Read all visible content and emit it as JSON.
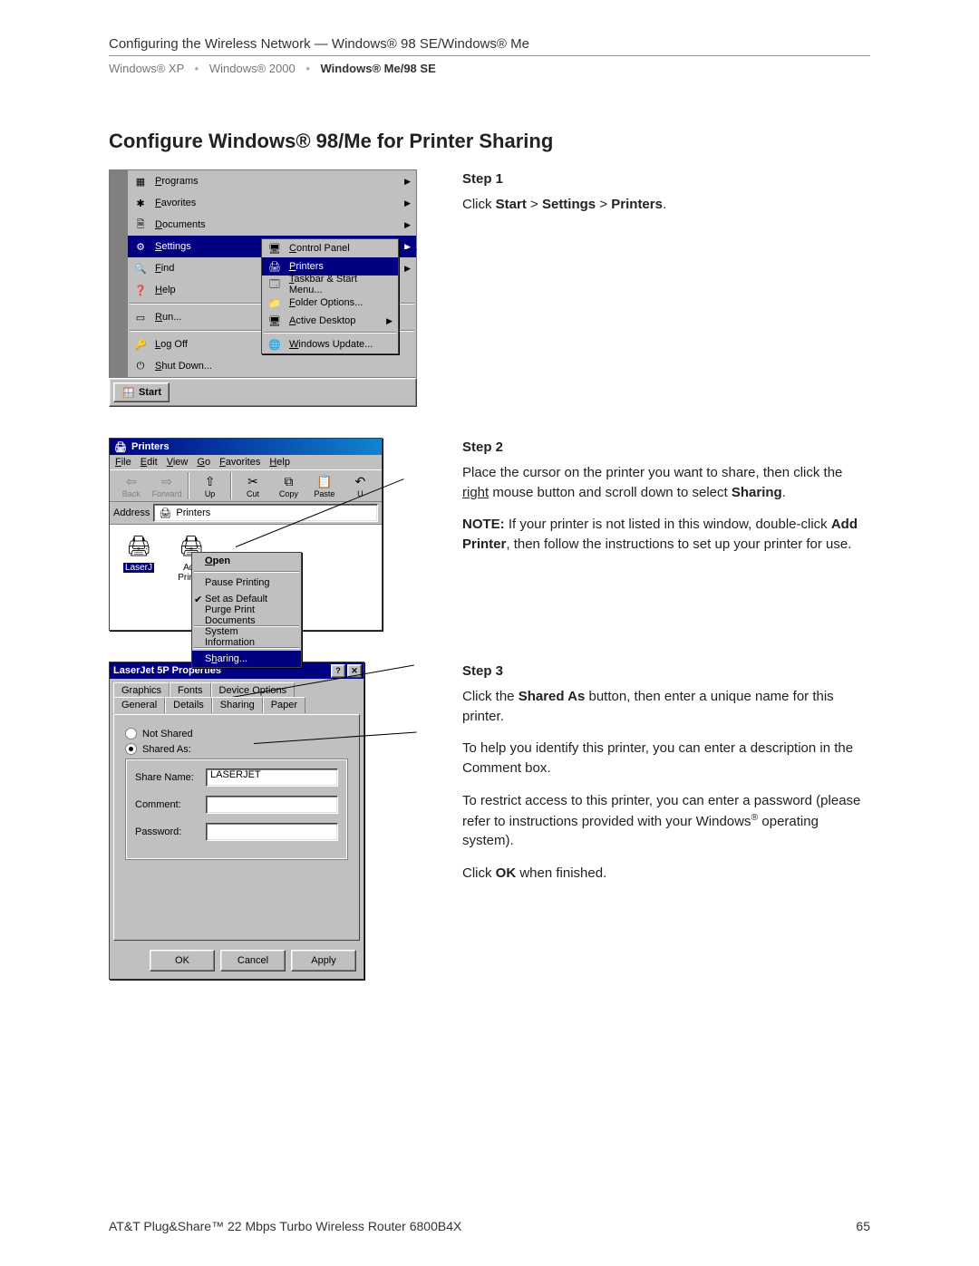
{
  "header": {
    "section": "Configuring the Wireless Network — Windows® 98 SE/Windows® Me",
    "breadcrumb": {
      "a": "Windows® XP",
      "b": "Windows® 2000",
      "c": "Windows® Me/98 SE"
    }
  },
  "title": "Configure Windows® 98/Me for Printer Sharing",
  "start_menu": {
    "items": [
      {
        "icon": "▦",
        "label": "Programs",
        "arrow": true
      },
      {
        "icon": "✱",
        "label": "Favorites",
        "arrow": true
      },
      {
        "icon": "🗎",
        "label": "Documents",
        "arrow": true
      },
      {
        "icon": "⚙",
        "label": "Settings",
        "arrow": true,
        "hl": true
      },
      {
        "icon": "🔍",
        "label": "Find",
        "arrow": true
      },
      {
        "icon": "❓",
        "label": "Help",
        "arrow": false
      },
      {
        "icon": "▭",
        "label": "Run...",
        "arrow": false
      },
      {
        "icon": "🔑",
        "label": "Log Off",
        "arrow": false
      },
      {
        "icon": "⏻",
        "label": "Shut Down...",
        "arrow": false
      }
    ],
    "settings_submenu": [
      {
        "icon": "🖥",
        "label": "Control Panel"
      },
      {
        "icon": "🖨",
        "label": "Printers",
        "hl": true
      },
      {
        "icon": "🗔",
        "label": "Taskbar & Start Menu..."
      },
      {
        "icon": "📁",
        "label": "Folder Options..."
      },
      {
        "icon": "🖥",
        "label": "Active Desktop",
        "arrow": true
      },
      {
        "icon": "🌐",
        "label": "Windows Update..."
      }
    ],
    "start_button": "Start"
  },
  "step1": {
    "label": "Step 1",
    "text_pre": "Click ",
    "b1": "Start",
    "gt1": " > ",
    "b2": "Settings",
    "gt2": " > ",
    "b3": "Printers",
    "end": "."
  },
  "printers_window": {
    "title": "Printers",
    "menus": [
      "File",
      "Edit",
      "View",
      "Go",
      "Favorites",
      "Help"
    ],
    "toolbar": [
      "Back",
      "Forward",
      "Up",
      "Cut",
      "Copy",
      "Paste",
      "U"
    ],
    "address_label": "Address",
    "address_value": "Printers",
    "icons": [
      {
        "name": "Add Printer",
        "glyph": "🖨"
      },
      {
        "name": "LaserJ",
        "glyph": "🖨",
        "sel": true
      }
    ],
    "context_menu": [
      {
        "label": "Open",
        "bold": true
      },
      {
        "sep": true
      },
      {
        "label": "Pause Printing"
      },
      {
        "label": "Set as Default",
        "checked": true
      },
      {
        "label": "Purge Print Documents"
      },
      {
        "sep": true
      },
      {
        "label": "System Information"
      },
      {
        "sep": true
      },
      {
        "label": "Sharing...",
        "hl": true
      }
    ]
  },
  "step2": {
    "label": "Step 2",
    "l1a": "Place the cursor on the printer you want to share, then click the ",
    "l1u": "right",
    "l1b": " mouse button and scroll down to select ",
    "l1bold": "Sharing",
    "l1end": ".",
    "note_label": "NOTE:",
    "note_a": " If your printer is not listed in this window, double-click ",
    "note_b": "Add Printer",
    "note_c": ", then follow the instructions to set up your printer for use."
  },
  "props": {
    "title": "LaserJet 5P Properties",
    "tabs_top": [
      "Graphics",
      "Fonts",
      "Device Options"
    ],
    "tabs_bottom": [
      "General",
      "Details",
      "Sharing",
      "Paper"
    ],
    "radio_not_shared": "Not Shared",
    "radio_shared": "Shared As:",
    "share_name_lbl": "Share Name:",
    "share_name_val": "LASERJET",
    "comment_lbl": "Comment:",
    "comment_val": "",
    "password_lbl": "Password:",
    "password_val": "",
    "buttons": {
      "ok": "OK",
      "cancel": "Cancel",
      "apply": "Apply"
    }
  },
  "step3": {
    "label": "Step 3",
    "p1a": "Click the ",
    "p1b": "Shared As",
    "p1c": " button, then enter a unique name for this printer.",
    "p2": "To help you identify this printer, you can enter a description in the Comment box.",
    "p3a": "To restrict access to this printer, you can enter a password (please refer to instructions provided with your Windows",
    "p3b": "® operating system).",
    "p4a": "Click ",
    "p4b": "OK",
    "p4c": " when finished."
  },
  "footer": {
    "left": "AT&T Plug&Share™ 22 Mbps Turbo Wireless Router 6800B4X",
    "right": "65"
  }
}
